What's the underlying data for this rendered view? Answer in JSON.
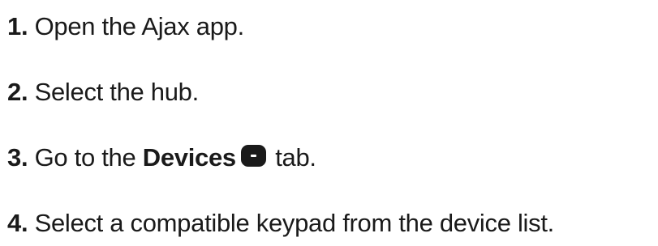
{
  "steps": [
    {
      "number": "1.",
      "text": "Open the Ajax app."
    },
    {
      "number": "2.",
      "text": "Select the hub."
    },
    {
      "number": "3.",
      "text_before": "Go to the",
      "bold_text": "Devices",
      "icon": "devices-tab-icon",
      "text_after": "tab."
    },
    {
      "number": "4.",
      "text": "Select a compatible keypad from the device list."
    }
  ]
}
